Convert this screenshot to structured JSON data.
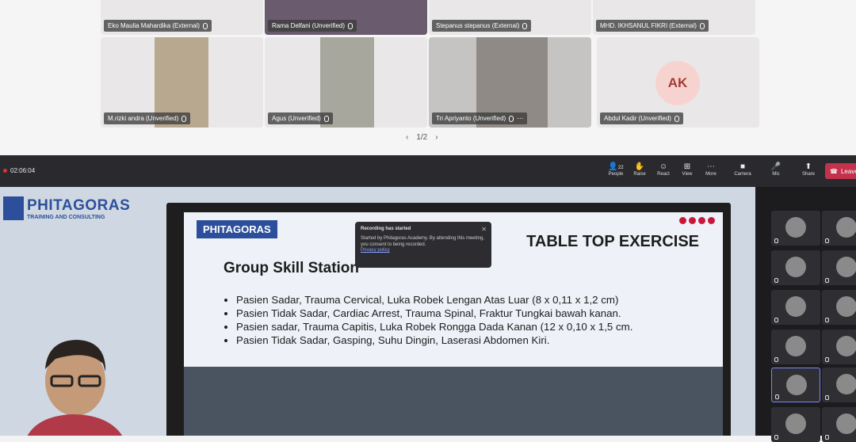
{
  "participants_top": [
    {
      "name": "Eko Maulia Mahardika (External)"
    },
    {
      "name": "Rama Delfani (Unverified)"
    },
    {
      "name": "Stepanus stepanus (External)"
    },
    {
      "name": "MHD. IKHSANUL FIKRI (External)"
    },
    {
      "name": "M.rizki andra (Unverified)"
    },
    {
      "name": "Agus (Unverified)"
    },
    {
      "name": "Tri Apriyanto (Unverified)"
    },
    {
      "name": "Abdul Kadir (Unverified)",
      "initials": "AK"
    }
  ],
  "pager": {
    "label": "1/2",
    "prev": "‹",
    "next": "›"
  },
  "toolbar": {
    "timer": "02:06:04",
    "people_count": "22",
    "people_label": "People",
    "raise_label": "Raise",
    "react_label": "React",
    "view_label": "View",
    "more_label": "More",
    "camera_label": "Camera",
    "mic_label": "Mic",
    "share_label": "Share",
    "leave_label": "Leave"
  },
  "toast": {
    "title": "Recording has started",
    "body": "Started by Phitagoras Academy. By attending this meeting, you consent to being recorded.",
    "link": "Privacy policy",
    "close": "✕"
  },
  "stage": {
    "brand": "PHITAGORAS",
    "brand_sub": "TRAINING AND CONSULTING",
    "slide_logo": "PHITAGORAS",
    "slide_title": "TABLE TOP EXERCISE",
    "slide_heading": "Group Skill Station",
    "slide_items": [
      "Pasien Sadar, Trauma Cervical, Luka Robek Lengan Atas Luar (8 x 0,11 x 1,2 cm)",
      "Pasien Tidak Sadar, Cardiac Arrest, Trauma Spinal, Fraktur Tungkai bawah kanan.",
      "Pasien sadar, Trauma Capitis, Luka Robek Rongga Dada Kanan (12 x 0,10 x 1,5 cm.",
      "Pasien Tidak Sadar, Gasping, Suhu Dingin, Laserasi Abdomen Kiri."
    ]
  },
  "colors": {
    "brand": "#2d4f9b",
    "leave": "#c4314b",
    "accent": "#7f85f5"
  }
}
